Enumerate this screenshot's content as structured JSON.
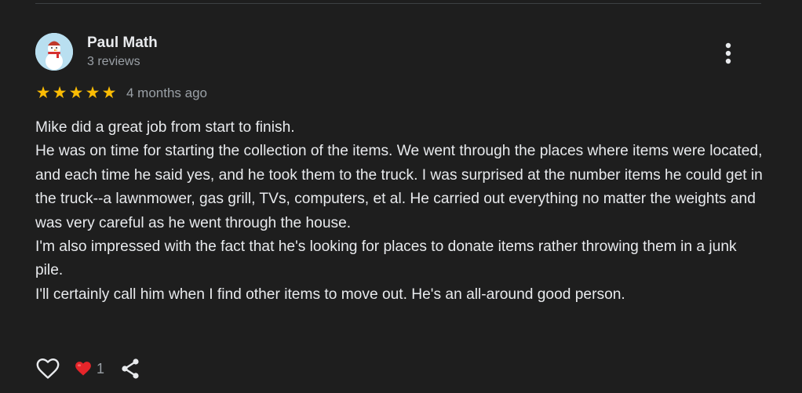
{
  "review": {
    "reviewer": {
      "name": "Paul Math",
      "review_count": "3 reviews",
      "avatar_icon": "snowman-avatar"
    },
    "rating": 5,
    "rating_max": 5,
    "star_glyph": "★",
    "date": "4 months ago",
    "paragraphs": [
      "Mike did a great job from start to finish.",
      "He was on time for starting the collection of the items. We went through the places where items were located, and each time he said yes, and he took them to the truck. I was surprised at the number items he could get in the truck--a lawnmower, gas grill, TVs, computers, et al. He carried out everything no matter the weights and was very careful as he went through the house.",
      "I'm also impressed with the fact that he's looking for places to donate items rather throwing them in a junk pile.",
      "I'll certainly call him when I find other items to move out. He's an all-around good person."
    ],
    "reactions": {
      "like_icon": "heart-outline-icon",
      "reaction_icon": "red-heart-icon",
      "reaction_count": "1",
      "share_icon": "share-icon"
    }
  },
  "menu_icon": "more-vert-icon",
  "colors": {
    "background": "#1e1e1e",
    "text_primary": "#e8eaed",
    "text_secondary": "#9aa0a6",
    "star": "#fbbc04",
    "reaction_heart": "#e5252a"
  }
}
